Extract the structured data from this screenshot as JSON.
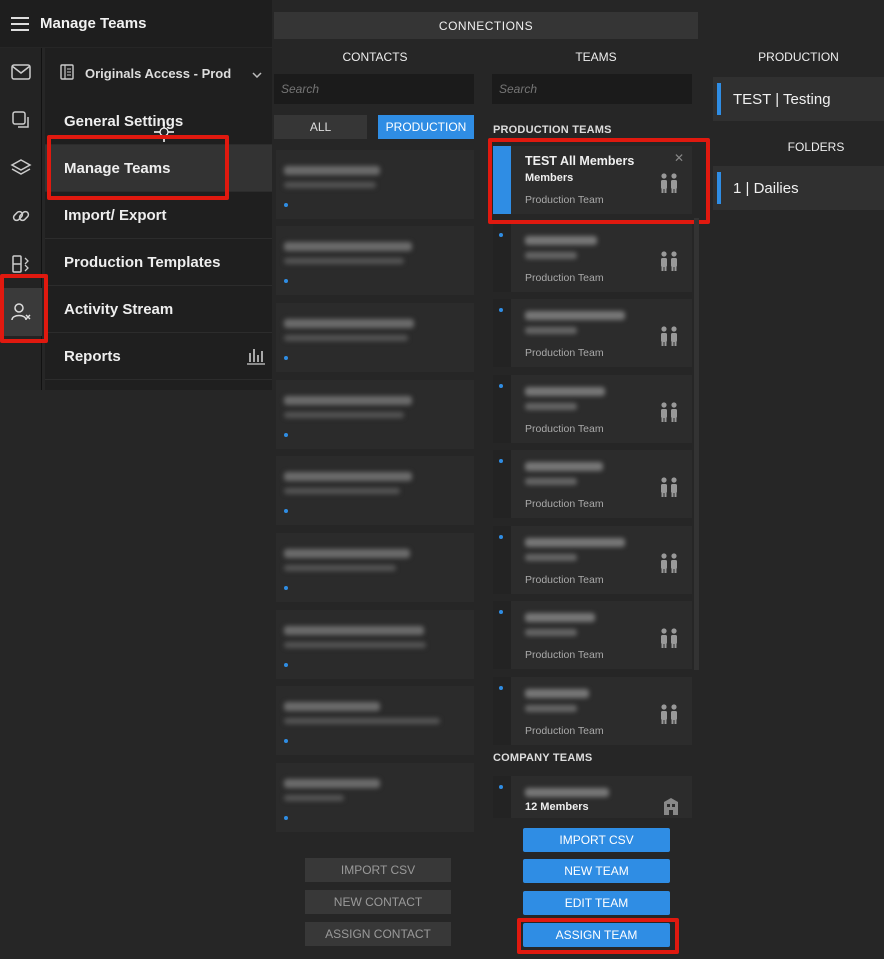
{
  "app": {
    "title": "Manage Teams"
  },
  "nav": {
    "org_selector": "Originals Access - Prod",
    "items": [
      {
        "label": "General Settings"
      },
      {
        "label": "Manage Teams"
      },
      {
        "label": "Import/ Export"
      },
      {
        "label": "Production Templates"
      },
      {
        "label": "Activity Stream"
      },
      {
        "label": "Reports"
      }
    ],
    "rail_icons": [
      "mail-icon",
      "copy-icon",
      "layers-icon",
      "link-icon",
      "template-icon",
      "user-manage-icon"
    ]
  },
  "connections": {
    "header": "CONNECTIONS"
  },
  "contacts": {
    "header": "CONTACTS",
    "search_placeholder": "Search",
    "filters": [
      "ALL",
      "PRODUCTION"
    ],
    "active_filter": "PRODUCTION",
    "buttons": [
      "IMPORT CSV",
      "NEW CONTACT",
      "ASSIGN CONTACT"
    ]
  },
  "teams": {
    "header": "TEAMS",
    "search_placeholder": "Search",
    "production_label": "PRODUCTION TEAMS",
    "production_teams": [
      {
        "name": "TEST All Members",
        "members": "Members",
        "type": "Production Team",
        "selected": true
      },
      {
        "name": "",
        "members": "",
        "type": "Production Team",
        "selected": false
      },
      {
        "name": "",
        "members": "",
        "type": "Production Team",
        "selected": false
      },
      {
        "name": "",
        "members": "",
        "type": "Production Team",
        "selected": false
      },
      {
        "name": "",
        "members": "",
        "type": "Production Team",
        "selected": false
      },
      {
        "name": "",
        "members": "",
        "type": "Production Team",
        "selected": false
      },
      {
        "name": "",
        "members": "",
        "type": "Production Team",
        "selected": false
      },
      {
        "name": "",
        "members": "",
        "type": "Production Team",
        "selected": false
      }
    ],
    "company_label": "COMPANY TEAMS",
    "company_teams": [
      {
        "name": "",
        "members": "12 Members"
      }
    ],
    "buttons": [
      "IMPORT CSV",
      "NEW TEAM",
      "EDIT TEAM",
      "ASSIGN TEAM"
    ]
  },
  "production": {
    "header": "PRODUCTION",
    "item": "TEST | Testing",
    "folders_header": "FOLDERS",
    "folder": "1 | Dailies"
  },
  "colors": {
    "accent": "#2f8de4",
    "highlight": "#e0190f",
    "background": "#262626"
  }
}
